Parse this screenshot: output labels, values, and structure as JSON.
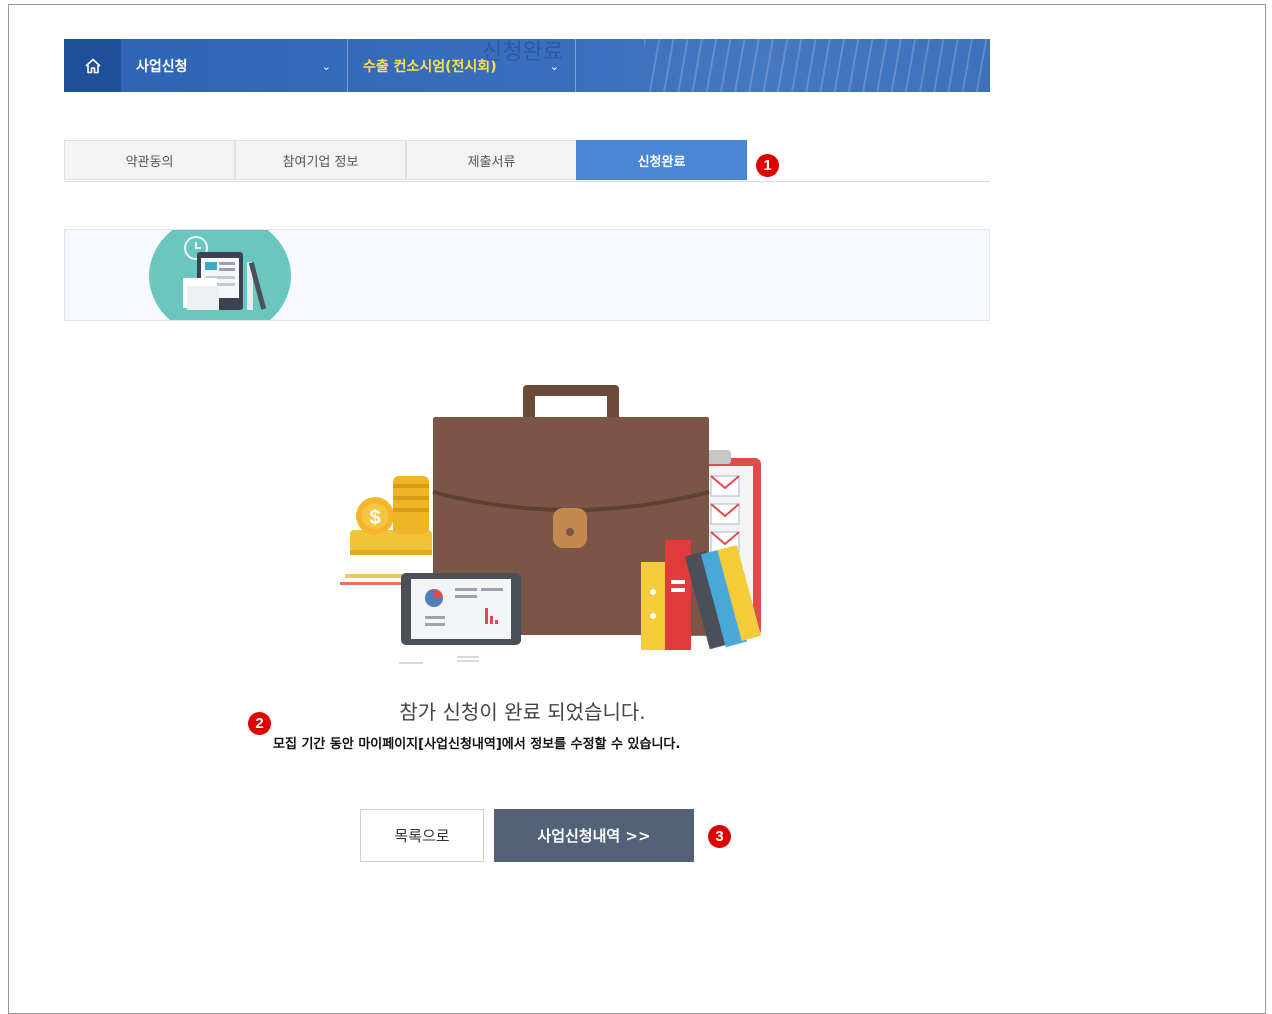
{
  "nav": {
    "menu1": "사업신청",
    "menu2": "수출 컨소시엄(전시회)"
  },
  "steps": [
    {
      "label": "약관동의"
    },
    {
      "label": "참여기업 정보"
    },
    {
      "label": "제출서류"
    },
    {
      "label": "신청완료"
    }
  ],
  "markers": [
    "1",
    "2",
    "3"
  ],
  "banner": {
    "title": "신청완료"
  },
  "message": {
    "main": "참가 신청이 완료 되었습니다.",
    "sub": "모집 기간 동안 마이페이지[사업신청내역]에서 정보를 수정할 수 있습니다."
  },
  "buttons": {
    "list": "목록으로",
    "history": "사업신청내역 >>"
  },
  "colors": {
    "nav_bg": "#2e63b4",
    "nav_home_bg": "#1f4f98",
    "nav_highlight": "#ffe14a",
    "step_active": "#4a86d4",
    "banner_title": "#2d58a6",
    "marker": "#e00000",
    "history_button": "#536179"
  }
}
